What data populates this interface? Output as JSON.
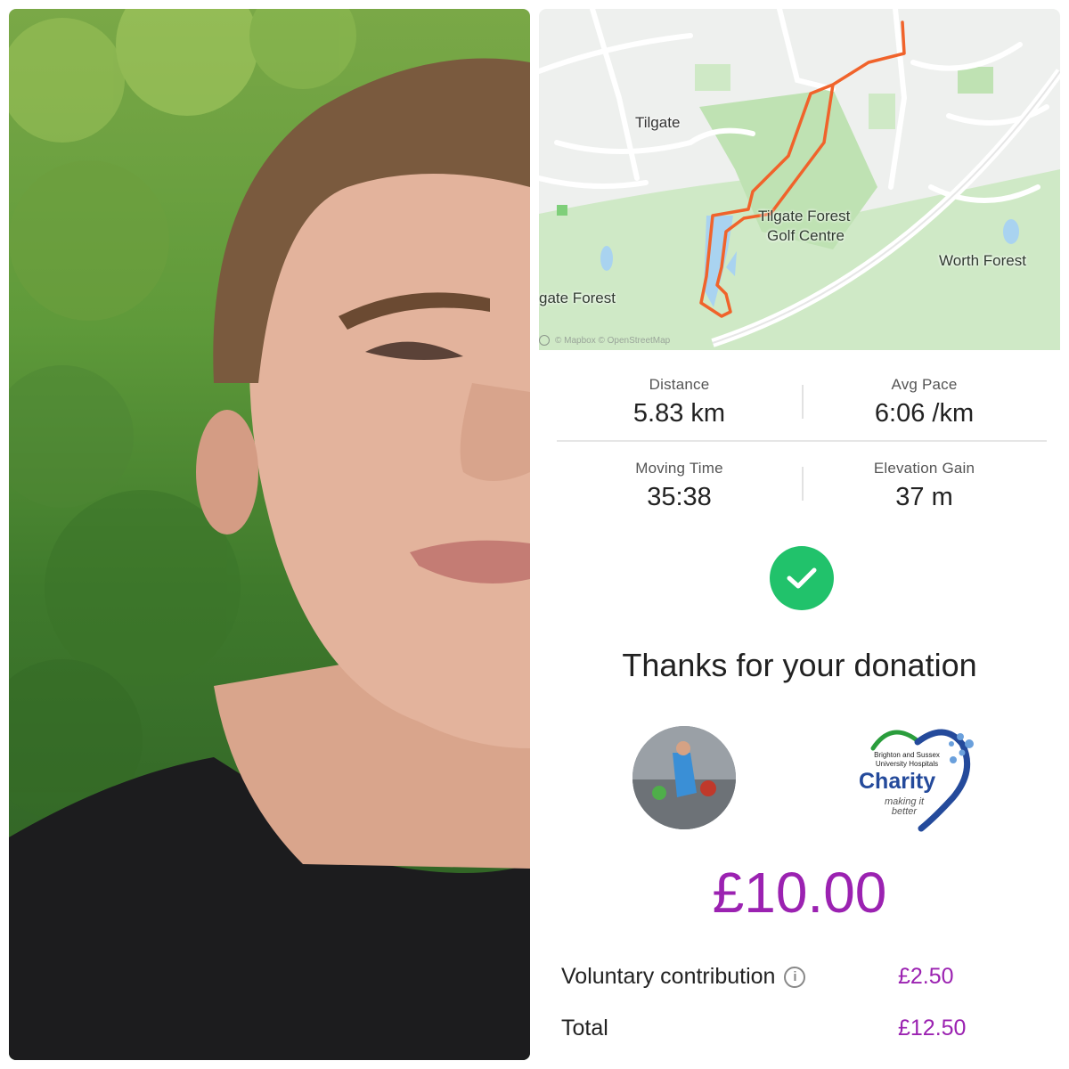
{
  "map": {
    "labels": {
      "tilgate": "Tilgate",
      "golf_line1": "Tilgate Forest",
      "golf_line2": "Golf Centre",
      "worth": "Worth Forest",
      "forest": "gate Forest"
    },
    "attribution": "© Mapbox © OpenStreetMap"
  },
  "stats": [
    {
      "label": "Distance",
      "value": "5.83 km"
    },
    {
      "label": "Avg Pace",
      "value": "6:06 /km"
    },
    {
      "label": "Moving Time",
      "value": "35:38"
    },
    {
      "label": "Elevation Gain",
      "value": "37 m"
    }
  ],
  "confirmation": {
    "icon": "checkmark-icon",
    "message": "Thanks for your donation"
  },
  "charity": {
    "small_text_line1": "Brighton and Sussex",
    "small_text_line2": "University Hospitals",
    "name": "Charity",
    "tagline_line1": "making it",
    "tagline_line2": "better"
  },
  "donation": {
    "amount": "£10.00",
    "voluntary_label": "Voluntary contribution",
    "voluntary_value": "£2.50",
    "total_label": "Total",
    "total_value": "£12.50"
  },
  "colors": {
    "route": "#f0632b",
    "success": "#21c26b",
    "amount": "#9b22b1",
    "charity_blue": "#244a9b"
  }
}
